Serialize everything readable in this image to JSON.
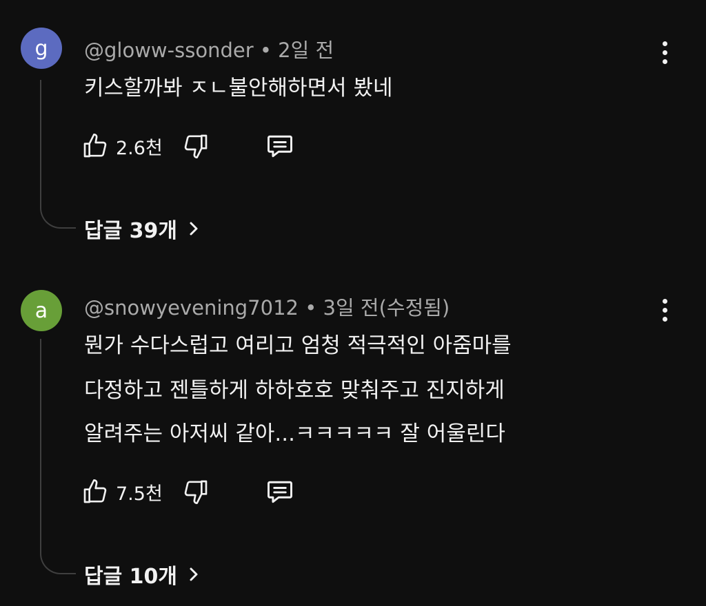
{
  "comments": [
    {
      "avatar_letter": "g",
      "avatar_color": "#5c6bc0",
      "handle": "@gloww-ssonder",
      "separator": "•",
      "time": "2일 전",
      "lines": [
        "키스할까봐 ㅈㄴ불안해하면서 봤네"
      ],
      "likes": "2.6천",
      "replies_label": "답글 39개"
    },
    {
      "avatar_letter": "a",
      "avatar_color": "#689f38",
      "handle": "@snowyevening7012",
      "separator": "•",
      "time": "3일 전(수정됨)",
      "lines": [
        "뭔가 수다스럽고 여리고 엄청 적극적인 아줌마를",
        "다정하고 젠틀하게 하하호호 맞춰주고 진지하게",
        "알려주는 아저씨 같아...ㅋㅋㅋㅋㅋ 잘 어울린다"
      ],
      "likes": "7.5천",
      "replies_label": "답글 10개"
    }
  ],
  "icons": {
    "like": "thumbs-up-icon",
    "dislike": "thumbs-down-icon",
    "reply": "comment-reply-icon",
    "more": "more-vertical-icon",
    "chevron": "chevron-right-icon"
  }
}
